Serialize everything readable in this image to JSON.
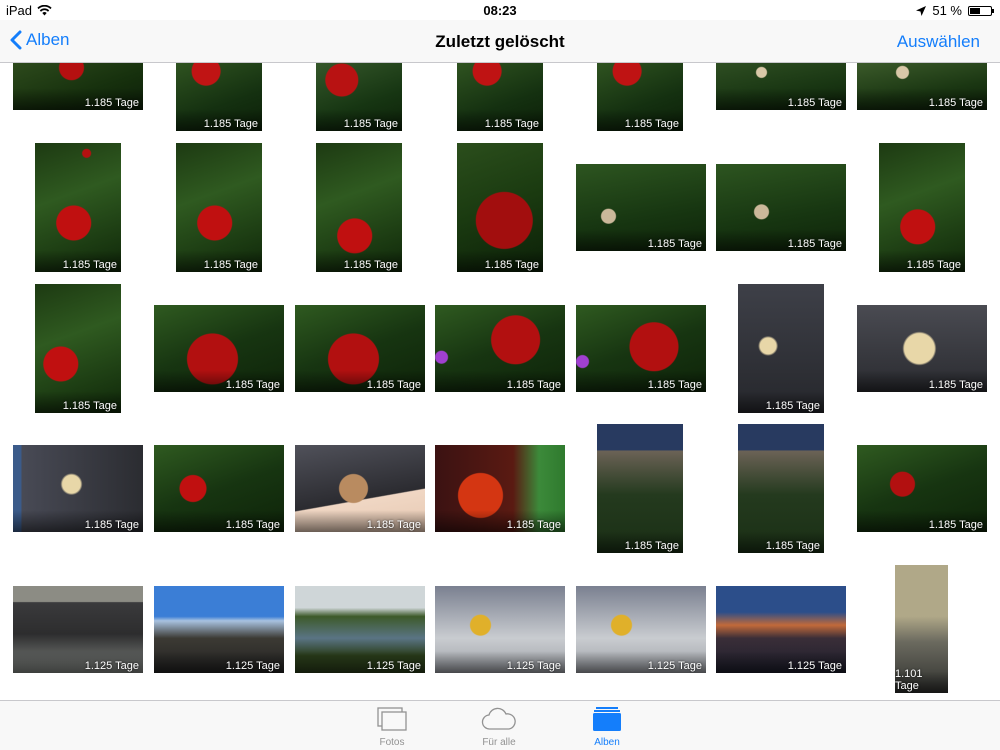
{
  "status_bar": {
    "device": "iPad",
    "time": "08:23",
    "battery_percent": "51 %",
    "battery_level": 0.51
  },
  "nav": {
    "back_label": "Alben",
    "title": "Zuletzt gelöscht",
    "select_label": "Auswählen"
  },
  "photos": [
    {
      "days": "1.185 Tage"
    },
    {
      "days": "1.185 Tage"
    },
    {
      "days": "1.185 Tage"
    },
    {
      "days": "1.185 Tage"
    },
    {
      "days": "1.185 Tage"
    },
    {
      "days": "1.185 Tage"
    },
    {
      "days": "1.185 Tage"
    },
    {
      "days": "1.185 Tage"
    },
    {
      "days": "1.185 Tage"
    },
    {
      "days": "1.185 Tage"
    },
    {
      "days": "1.185 Tage"
    },
    {
      "days": "1.185 Tage"
    },
    {
      "days": "1.185 Tage"
    },
    {
      "days": "1.185 Tage"
    },
    {
      "days": "1.185 Tage"
    },
    {
      "days": "1.185 Tage"
    },
    {
      "days": "1.185 Tage"
    },
    {
      "days": "1.185 Tage"
    },
    {
      "days": "1.185 Tage"
    },
    {
      "days": "1.185 Tage"
    },
    {
      "days": "1.185 Tage"
    },
    {
      "days": "1.185 Tage"
    },
    {
      "days": "1.185 Tage"
    },
    {
      "days": "1.185 Tage"
    },
    {
      "days": "1.185 Tage"
    },
    {
      "days": "1.185 Tage"
    },
    {
      "days": "1.185 Tage"
    },
    {
      "days": "1.185 Tage"
    },
    {
      "days": "1.125 Tage"
    },
    {
      "days": "1.125 Tage"
    },
    {
      "days": "1.125 Tage"
    },
    {
      "days": "1.125 Tage"
    },
    {
      "days": "1.125 Tage"
    },
    {
      "days": "1.125 Tage"
    },
    {
      "days": "1.101 Tage"
    }
  ],
  "tabs": [
    {
      "label": "Fotos",
      "icon": "photos-icon"
    },
    {
      "label": "Für alle",
      "icon": "cloud-icon"
    },
    {
      "label": "Alben",
      "icon": "albums-icon",
      "active": true
    }
  ],
  "colors": {
    "accent": "#147efb"
  }
}
